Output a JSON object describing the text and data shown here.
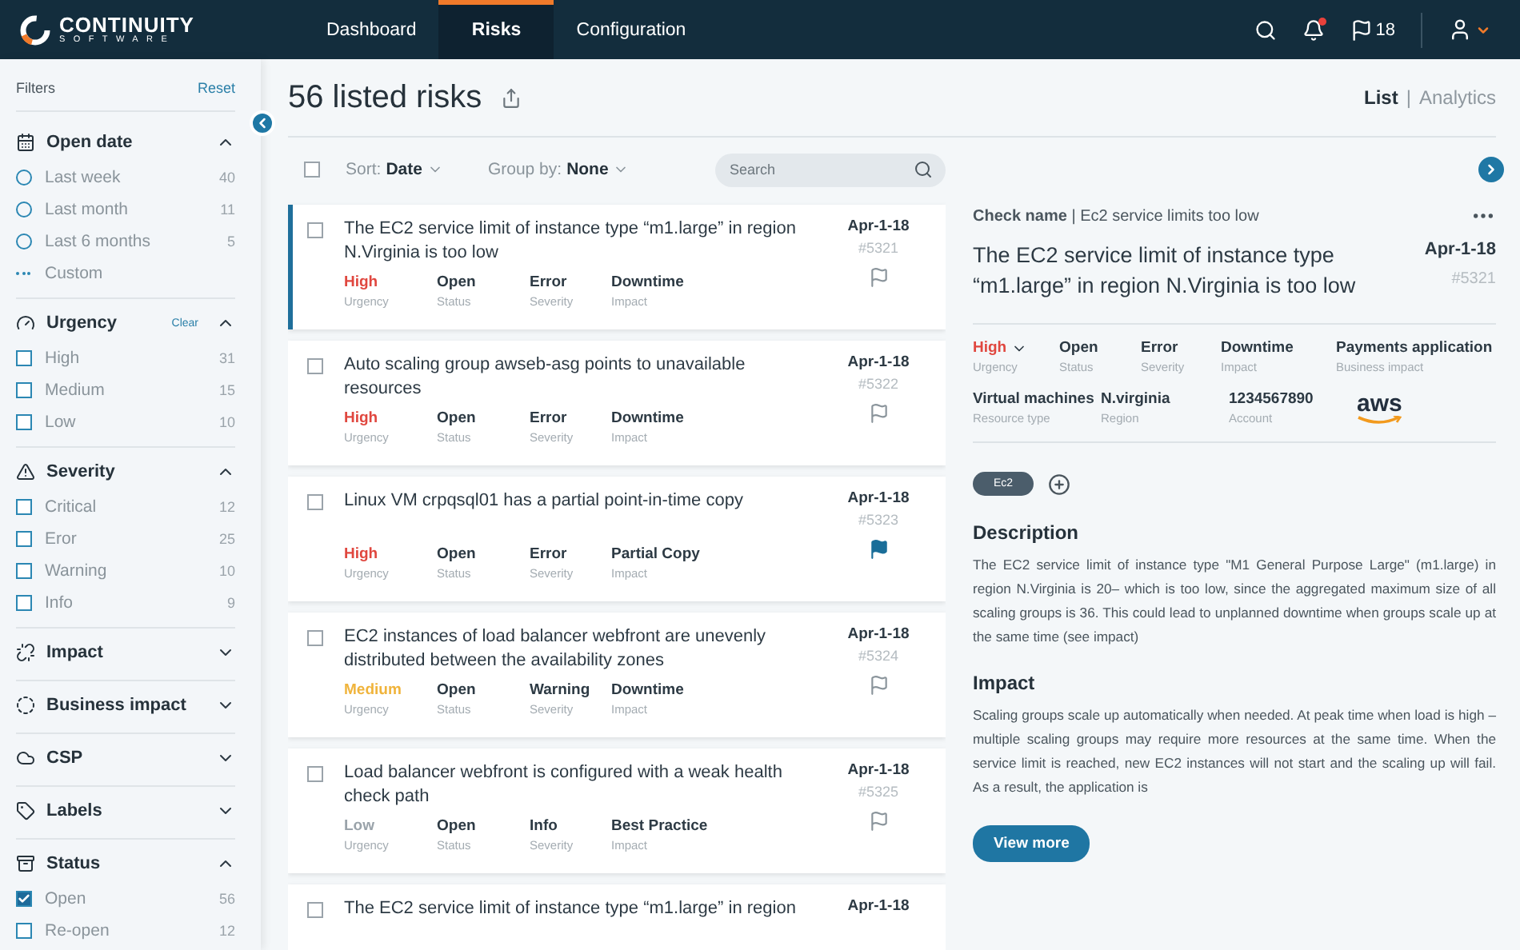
{
  "header": {
    "logo": {
      "name": "CONTINUITY",
      "tagline": "SOFTWARE"
    },
    "nav": [
      {
        "label": "Dashboard",
        "selected": false
      },
      {
        "label": "Risks",
        "selected": true
      },
      {
        "label": "Configuration",
        "selected": false
      }
    ],
    "notifications_unread": true,
    "flag_count": "18"
  },
  "sidebar": {
    "title": "Filters",
    "reset": "Reset",
    "groups": [
      {
        "title": "Open date",
        "expanded": true,
        "options": [
          {
            "kind": "radio",
            "label": "Last week",
            "count": "40",
            "selected": false
          },
          {
            "kind": "radio",
            "label": "Last month",
            "count": "11",
            "selected": false
          },
          {
            "kind": "radio",
            "label": "Last 6 months",
            "count": "5",
            "selected": false
          },
          {
            "kind": "custom",
            "label": "Custom"
          }
        ]
      },
      {
        "title": "Urgency",
        "expanded": true,
        "clear": "Clear",
        "options": [
          {
            "kind": "checkbox",
            "label": "High",
            "count": "31",
            "checked": false
          },
          {
            "kind": "checkbox",
            "label": "Medium",
            "count": "15",
            "checked": false
          },
          {
            "kind": "checkbox",
            "label": "Low",
            "count": "10",
            "checked": false
          }
        ]
      },
      {
        "title": "Severity",
        "expanded": true,
        "options": [
          {
            "kind": "checkbox",
            "label": "Critical",
            "count": "12",
            "checked": false
          },
          {
            "kind": "checkbox",
            "label": "Eror",
            "count": "25",
            "checked": false
          },
          {
            "kind": "checkbox",
            "label": "Warning",
            "count": "10",
            "checked": false
          },
          {
            "kind": "checkbox",
            "label": "Info",
            "count": "9",
            "checked": false
          }
        ]
      },
      {
        "title": "Impact",
        "expanded": false
      },
      {
        "title": "Business impact",
        "expanded": false
      },
      {
        "title": "CSP",
        "expanded": false
      },
      {
        "title": "Labels",
        "expanded": false
      },
      {
        "title": "Status",
        "expanded": true,
        "options": [
          {
            "kind": "checkbox",
            "label": "Open",
            "count": "56",
            "checked": true
          },
          {
            "kind": "checkbox",
            "label": "Re-open",
            "count": "12",
            "checked": false
          }
        ]
      }
    ]
  },
  "list": {
    "title": "56 listed risks",
    "views": [
      {
        "label": "List",
        "selected": true
      },
      {
        "label": "Analytics",
        "selected": false
      }
    ],
    "view_separator": "|",
    "select_all_checked": false,
    "sort_label": "Sort:",
    "sort_value": "Date",
    "group_label": "Group by:",
    "group_value": "None",
    "search": {
      "placeholder": "Search"
    },
    "risks": [
      {
        "title": "The EC2 service limit of instance type “m1.large” in region N.Virginia is too low",
        "date": "Apr-1-18",
        "id": "#5321",
        "selected": true,
        "checked": false,
        "flagged": false,
        "fields": [
          {
            "value": "High",
            "label": "Urgency",
            "color": "#e0473f"
          },
          {
            "value": "Open",
            "label": "Status"
          },
          {
            "value": "Error",
            "label": "Severity"
          },
          {
            "value": "Downtime",
            "label": "Impact"
          }
        ]
      },
      {
        "title": "Auto scaling group awseb-asg points to unavailable resources",
        "date": "Apr-1-18",
        "id": "#5322",
        "selected": false,
        "checked": false,
        "flagged": false,
        "fields": [
          {
            "value": "High",
            "label": "Urgency",
            "color": "#e0473f"
          },
          {
            "value": "Open",
            "label": "Status"
          },
          {
            "value": "Error",
            "label": "Severity"
          },
          {
            "value": "Downtime",
            "label": "Impact"
          }
        ]
      },
      {
        "title": "Linux VM crpqsql01 has a partial point-in-time copy",
        "date": "Apr-1-18",
        "id": "#5323",
        "selected": false,
        "checked": false,
        "flagged": true,
        "fields": [
          {
            "value": "High",
            "label": "Urgency",
            "color": "#e0473f"
          },
          {
            "value": "Open",
            "label": "Status"
          },
          {
            "value": "Error",
            "label": "Severity"
          },
          {
            "value": "Partial Copy",
            "label": "Impact"
          }
        ]
      },
      {
        "title": "EC2 instances of load balancer webfront are unevenly distributed between the availability zones",
        "date": "Apr-1-18",
        "id": "#5324",
        "selected": false,
        "checked": false,
        "flagged": false,
        "fields": [
          {
            "value": "Medium",
            "label": "Urgency",
            "color": "#f0b43c"
          },
          {
            "value": "Open",
            "label": "Status"
          },
          {
            "value": "Warning",
            "label": "Severity"
          },
          {
            "value": "Downtime",
            "label": "Impact"
          }
        ]
      },
      {
        "title": "Load balancer webfront is configured with a weak health check path",
        "date": "Apr-1-18",
        "id": "#5325",
        "selected": false,
        "checked": false,
        "flagged": false,
        "fields": [
          {
            "value": "Low",
            "label": "Urgency",
            "color": "#9aa3aa"
          },
          {
            "value": "Open",
            "label": "Status"
          },
          {
            "value": "Info",
            "label": "Severity"
          },
          {
            "value": "Best Practice",
            "label": "Impact"
          }
        ]
      },
      {
        "title": "The EC2 service limit of instance type “m1.large” in region",
        "date": "Apr-1-18",
        "selected": false,
        "checked": false
      }
    ]
  },
  "detail": {
    "check_label": "Check name",
    "check_separator": "|",
    "check_name": "Ec2 service limits too low",
    "title": "The EC2 service limit of instance type “m1.large” in region N.Virginia is too low",
    "date": "Apr-1-18",
    "id": "#5321",
    "fields": [
      {
        "value": "High",
        "label": "Urgency",
        "color": "#e0473f",
        "has_menu": true
      },
      {
        "value": "Open",
        "label": "Status"
      },
      {
        "value": "Error",
        "label": "Severity"
      },
      {
        "value": "Downtime",
        "label": "Impact"
      },
      {
        "value": "Payments application",
        "label": "Business impact"
      }
    ],
    "resource_fields": [
      {
        "value": "Virtual machines",
        "label": "Resource type"
      },
      {
        "value": "N.virginia",
        "label": "Region"
      },
      {
        "value": "1234567890",
        "label": "Account"
      }
    ],
    "provider_logo": "aws",
    "tags": [
      {
        "label": "Ec2"
      }
    ],
    "sections": [
      {
        "heading": "Description",
        "text": "The EC2 service limit of instance type \"M1 General Purpose Large\" (m1.large) in region N.Virginia is 20– which is too low, since the aggregated maximum size of all scaling groups is 36. This could lead to unplanned downtime when groups scale up at the same time (see impact)"
      },
      {
        "heading": "Impact",
        "text": "Scaling groups scale up automatically when needed. At peak time when load is high – multiple scaling groups may require more resources at the same time. When the service limit is reached, new EC2 instances will not start and the scaling up will fail. As a result, the application is"
      }
    ],
    "button": "View more"
  }
}
